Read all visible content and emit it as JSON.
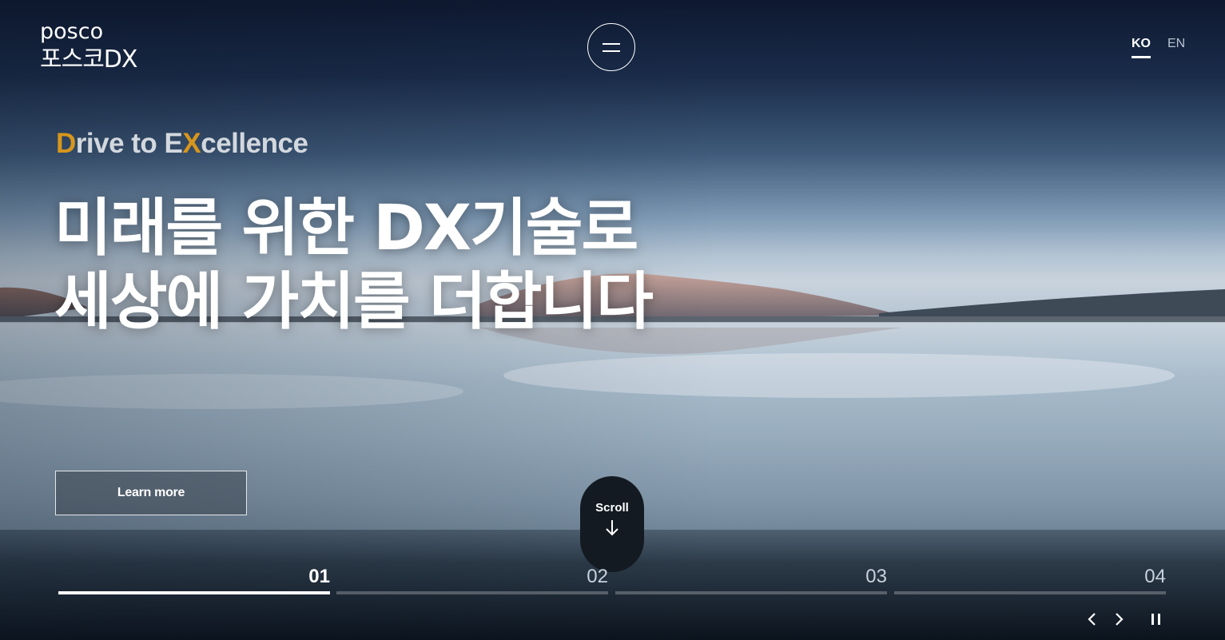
{
  "brand": {
    "logo_text": "posco",
    "site_name": "포스코DX"
  },
  "header": {
    "menu_icon": "hamburger-menu-icon",
    "languages": [
      {
        "code": "KO",
        "active": true
      },
      {
        "code": "EN",
        "active": false
      }
    ]
  },
  "hero": {
    "tagline_parts": [
      {
        "text": "D",
        "accent": true
      },
      {
        "text": "rive to E",
        "accent": false
      },
      {
        "text": "X",
        "accent": true
      },
      {
        "text": "cellence",
        "accent": false
      }
    ],
    "headline_line1": "미래를 위한 DX기술로",
    "headline_line2": "세상에 가치를 더합니다",
    "learn_more_label": "Learn more",
    "accent_color": "#d7961c"
  },
  "scroll": {
    "label": "Scroll",
    "icon": "arrow-down-icon"
  },
  "slides": {
    "items": [
      {
        "number": "01",
        "active": true,
        "progress": 1.0
      },
      {
        "number": "02",
        "active": false,
        "progress": 0
      },
      {
        "number": "03",
        "active": false,
        "progress": 0
      },
      {
        "number": "04",
        "active": false,
        "progress": 0
      }
    ],
    "controls": {
      "prev_icon": "chevron-left-icon",
      "next_icon": "chevron-right-icon",
      "pause_icon": "pause-icon"
    }
  }
}
